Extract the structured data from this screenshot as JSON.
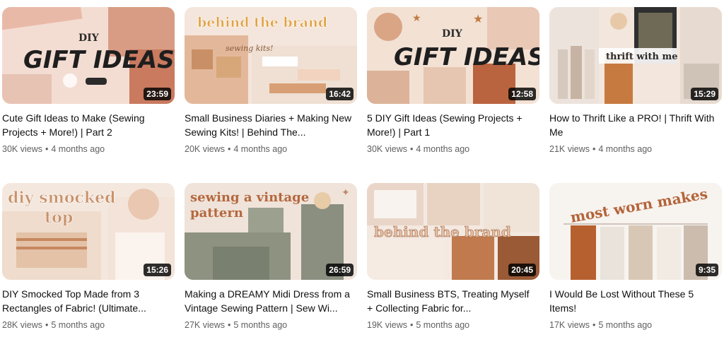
{
  "videos": [
    {
      "title": "Cute Gift Ideas to Make (Sewing Projects + More!) | Part 2",
      "views": "30K views",
      "age": "4 months ago",
      "duration": "23:59",
      "overlay": [
        "DIY",
        "GIFT IDEAS"
      ]
    },
    {
      "title": "Small Business Diaries + Making New Sewing Kits! | Behind The...",
      "views": "20K views",
      "age": "4 months ago",
      "duration": "16:42",
      "overlay": [
        "behind the brand",
        "sewing kits!"
      ]
    },
    {
      "title": "5 DIY Gift Ideas (Sewing Projects + More!) | Part 1",
      "views": "30K views",
      "age": "4 months ago",
      "duration": "12:58",
      "overlay": [
        "DIY",
        "GIFT IDEAS"
      ]
    },
    {
      "title": "How to Thrift Like a PRO! | Thrift With Me",
      "views": "21K views",
      "age": "4 months ago",
      "duration": "15:29",
      "overlay": [
        "thrift with me"
      ]
    },
    {
      "title": "DIY Smocked Top Made from 3 Rectangles of Fabric! (Ultimate...",
      "views": "28K views",
      "age": "5 months ago",
      "duration": "15:26",
      "overlay": [
        "diy smocked",
        "top"
      ]
    },
    {
      "title": "Making a DREAMY Midi Dress from a Vintage Sewing Pattern | Sew Wi...",
      "views": "27K views",
      "age": "5 months ago",
      "duration": "26:59",
      "overlay": [
        "sewing a vintage",
        "pattern"
      ]
    },
    {
      "title": "Small Business BTS, Treating Myself + Collecting Fabric for...",
      "views": "19K views",
      "age": "5 months ago",
      "duration": "20:45",
      "overlay": [
        "behind the brand"
      ]
    },
    {
      "title": "I Would Be Lost Without These 5 Items!",
      "views": "17K views",
      "age": "5 months ago",
      "duration": "9:35",
      "overlay": [
        "most worn makes"
      ]
    }
  ],
  "separator": "•"
}
